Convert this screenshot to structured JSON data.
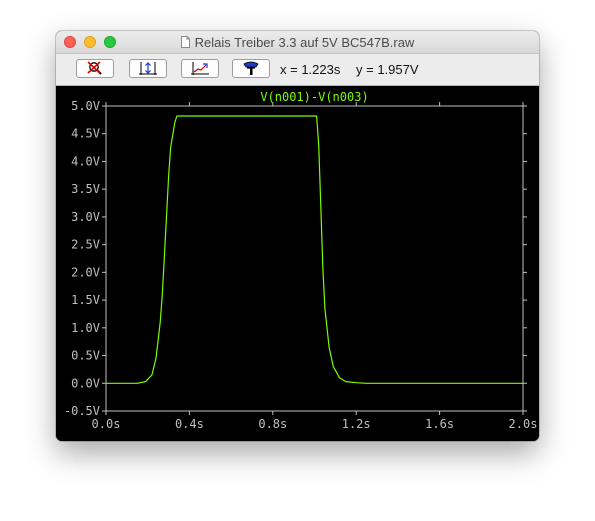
{
  "window": {
    "title": "Relais Treiber 3.3 auf 5V BC547B.raw"
  },
  "toolbar": {
    "buttons": [
      {
        "icon": "zoom-cancel-icon"
      },
      {
        "icon": "autorange-icon"
      },
      {
        "icon": "fit-icon"
      },
      {
        "icon": "probe-icon"
      }
    ],
    "cursor_x": "x = 1.223s",
    "cursor_y": "y = 1.957V"
  },
  "colors": {
    "trace": "#7cfc00",
    "axis": "#c0c0c0",
    "background": "#000000"
  },
  "chart_data": {
    "type": "line",
    "title": "V(n001)-V(n003)",
    "xlabel": "",
    "ylabel": "",
    "xlim": [
      0,
      2.0
    ],
    "ylim": [
      -0.5,
      5.0
    ],
    "grid": false,
    "x_ticks": [
      "0.0s",
      "0.4s",
      "0.8s",
      "1.2s",
      "1.6s",
      "2.0s"
    ],
    "y_ticks": [
      "5.0V",
      "4.5V",
      "4.0V",
      "3.5V",
      "3.0V",
      "2.5V",
      "2.0V",
      "1.5V",
      "1.0V",
      "0.5V",
      "0.0V",
      "-0.5V"
    ],
    "series": [
      {
        "name": "V(n001)-V(n003)",
        "x": [
          0.0,
          0.15,
          0.19,
          0.22,
          0.24,
          0.26,
          0.27,
          0.28,
          0.29,
          0.3,
          0.31,
          0.33,
          0.34,
          1.01,
          1.02,
          1.03,
          1.04,
          1.05,
          1.07,
          1.09,
          1.12,
          1.15,
          1.2,
          1.25,
          2.0
        ],
        "y": [
          0.0,
          0.0,
          0.03,
          0.15,
          0.45,
          1.1,
          1.6,
          2.3,
          3.0,
          3.7,
          4.25,
          4.7,
          4.82,
          4.82,
          4.3,
          3.2,
          2.1,
          1.35,
          0.65,
          0.3,
          0.1,
          0.03,
          0.01,
          0.0,
          0.0
        ]
      }
    ]
  }
}
